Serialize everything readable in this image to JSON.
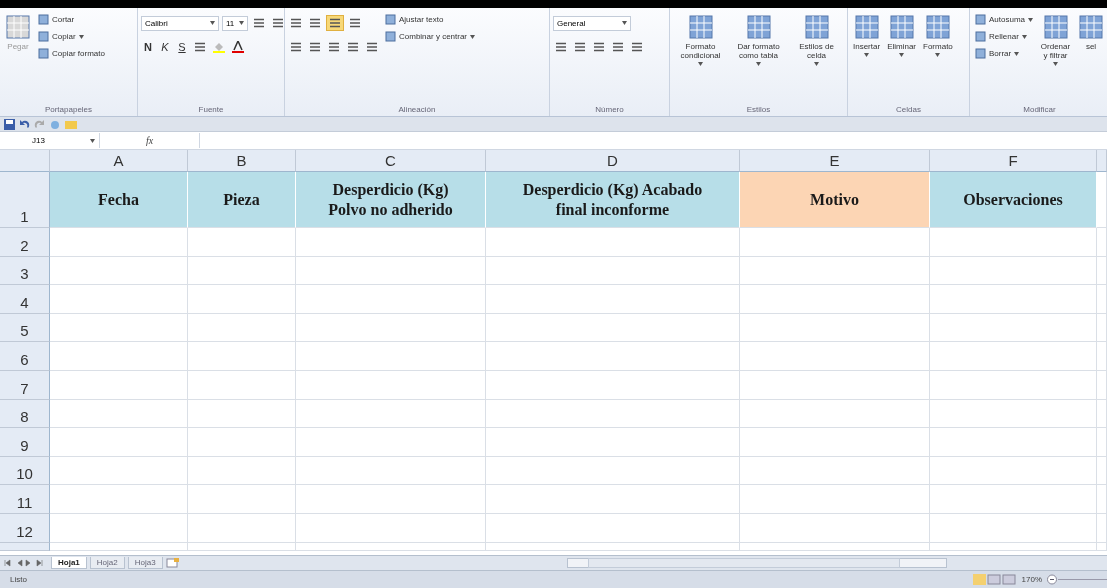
{
  "ribbon": {
    "groups": [
      {
        "label": "Portapapeles",
        "columns": [
          [
            {
              "kind": "large",
              "label": "Pegar",
              "disabled": true
            }
          ],
          [
            {
              "kind": "small",
              "label": "Cortar"
            },
            {
              "kind": "smallmenu",
              "label": "Copiar"
            },
            {
              "kind": "small",
              "label": "Copiar formato"
            }
          ]
        ]
      },
      {
        "label": "Fuente",
        "columns": [
          [
            {
              "kind": "row",
              "items": [
                {
                  "kind": "field",
                  "value": "Calibri"
                },
                {
                  "kind": "field",
                  "value": "11"
                },
                {
                  "kind": "tool"
                },
                {
                  "kind": "tool"
                }
              ]
            },
            {
              "kind": "row",
              "items": [
                {
                  "kind": "bold",
                  "label": "N"
                },
                {
                  "kind": "italic",
                  "label": "K"
                },
                {
                  "kind": "underline",
                  "label": "S"
                },
                {
                  "kind": "tool"
                },
                {
                  "kind": "fillcolor"
                },
                {
                  "kind": "fontcolor"
                }
              ]
            }
          ]
        ]
      },
      {
        "label": "Alineación",
        "columns": [
          [
            {
              "kind": "row",
              "items": [
                {
                  "kind": "tool",
                  "selected": false
                },
                {
                  "kind": "tool",
                  "selected": false
                },
                {
                  "kind": "tool",
                  "selected": true
                },
                {
                  "kind": "tool",
                  "selected": false
                }
              ]
            },
            {
              "kind": "row",
              "items": [
                {
                  "kind": "tool"
                },
                {
                  "kind": "tool"
                },
                {
                  "kind": "tool"
                },
                {
                  "kind": "tool"
                },
                {
                  "kind": "tool"
                }
              ]
            }
          ],
          [
            {
              "kind": "small",
              "label": "Ajustar texto"
            },
            {
              "kind": "smallmenu",
              "label": "Combinar y centrar"
            }
          ]
        ]
      },
      {
        "label": "Número",
        "columns": [
          [
            {
              "kind": "row",
              "items": [
                {
                  "kind": "field",
                  "value": "General"
                }
              ]
            },
            {
              "kind": "row",
              "items": [
                {
                  "kind": "tool"
                },
                {
                  "kind": "tool"
                },
                {
                  "kind": "tool"
                },
                {
                  "kind": "tool"
                },
                {
                  "kind": "tool"
                }
              ]
            }
          ]
        ]
      },
      {
        "label": "Estilos",
        "columns": [
          [
            {
              "kind": "largemenu",
              "label": "Formato condicional"
            }
          ],
          [
            {
              "kind": "largemenu",
              "label": "Dar formato como tabla"
            }
          ],
          [
            {
              "kind": "largemenu",
              "label": "Estilos de celda"
            }
          ]
        ]
      },
      {
        "label": "Celdas",
        "columns": [
          [
            {
              "kind": "largemenu",
              "label": "Insertar"
            }
          ],
          [
            {
              "kind": "largemenu",
              "label": "Eliminar"
            }
          ],
          [
            {
              "kind": "largemenu",
              "label": "Formato"
            }
          ]
        ]
      },
      {
        "label": "Modificar",
        "columns": [
          [
            {
              "kind": "smallmenu",
              "label": "Autosuma"
            },
            {
              "kind": "smallmenu",
              "label": "Rellenar"
            },
            {
              "kind": "smallmenu",
              "label": "Borrar"
            }
          ],
          [
            {
              "kind": "largemenu",
              "label": "Ordenar y filtrar"
            }
          ],
          [
            {
              "kind": "large",
              "label": "sel",
              "disabled": false
            }
          ]
        ]
      }
    ]
  },
  "name_box": {
    "value": "J13"
  },
  "formula_bar": {
    "fx": "fx"
  },
  "sheet": {
    "columns": [
      {
        "label": "A"
      },
      {
        "label": "B"
      },
      {
        "label": "C"
      },
      {
        "label": "D"
      },
      {
        "label": "E"
      },
      {
        "label": "F"
      }
    ],
    "header_row": {
      "label": "1",
      "cells": [
        {
          "text": "Fecha",
          "color": "#b7dee8"
        },
        {
          "text": "Pieza",
          "color": "#b7dee8"
        },
        {
          "text": "Desperdicio (Kg) Polvo no adherido",
          "color": "#b7dee8"
        },
        {
          "text": "Desperdicio (Kg) Acabado final inconforme",
          "color": "#b7dee8"
        },
        {
          "text": "Motivo",
          "color": "#fcd5b4"
        },
        {
          "text": "Observaciones",
          "color": "#b7dee8"
        }
      ]
    },
    "rows": [
      "2",
      "3",
      "4",
      "5",
      "6",
      "7",
      "8",
      "9",
      "10",
      "11",
      "12"
    ]
  },
  "sheet_tabs": [
    {
      "label": "Hoja1",
      "selected": true
    },
    {
      "label": "Hoja2",
      "selected": false
    },
    {
      "label": "Hoja3",
      "selected": false
    }
  ],
  "status_bar": {
    "text": "Listo",
    "zoom": "170%"
  }
}
